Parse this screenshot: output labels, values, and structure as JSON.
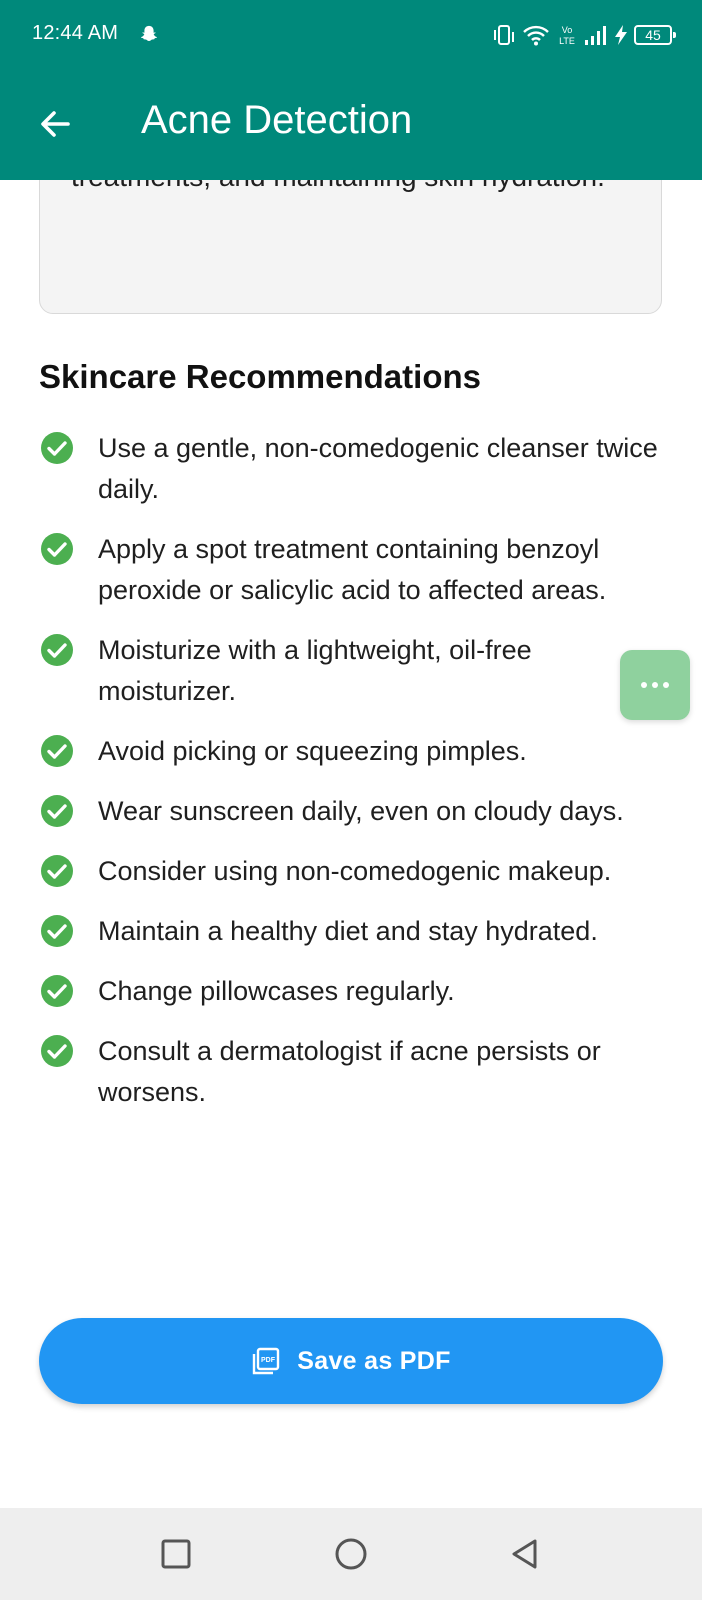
{
  "status_bar": {
    "time": "12:44 AM",
    "battery": "45",
    "icons": [
      "snapchat-icon",
      "vibrate-icon",
      "wifi-icon",
      "volte-icon",
      "signal-icon",
      "charging-icon",
      "battery-icon"
    ]
  },
  "app_bar": {
    "title": "Acne Detection",
    "back_icon": "arrow-left-icon"
  },
  "summary": {
    "text": "treatments, and maintaining skin hydration."
  },
  "recommendations": {
    "title": "Skincare Recommendations",
    "items": [
      "Use a gentle, non-comedogenic cleanser twice daily.",
      "Apply a spot treatment containing benzoyl peroxide or salicylic acid to affected areas.",
      "Moisturize with a lightweight, oil-free moisturizer.",
      "Avoid picking or squeezing pimples.",
      "Wear sunscreen daily, even on cloudy days.",
      "Consider using non-comedogenic makeup.",
      "Maintain a healthy diet and stay hydrated.",
      "Change pillowcases regularly.",
      "Consult a dermatologist if acne persists or worsens."
    ]
  },
  "actions": {
    "save_pdf": "Save as PDF",
    "pdf_icon_text": "PDF"
  },
  "colors": {
    "primary": "#00897B",
    "button": "#2196F3",
    "check": "#4CAF50",
    "floating": "#8fd19e"
  }
}
